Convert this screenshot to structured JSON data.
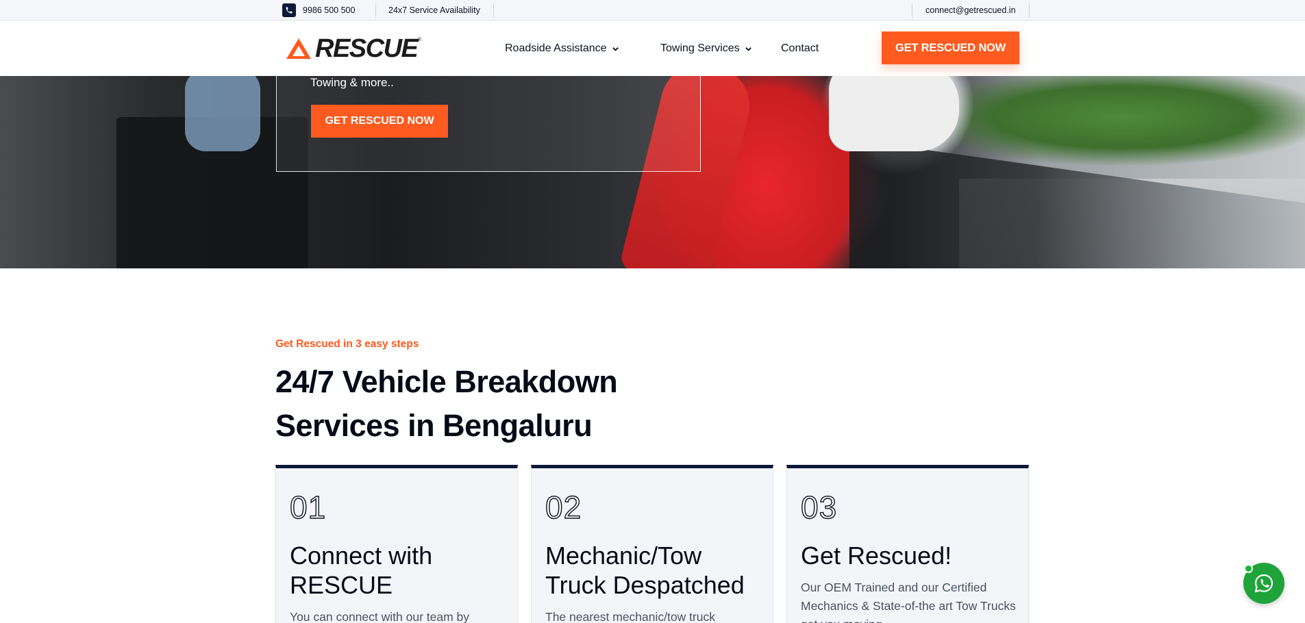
{
  "topbar": {
    "phone": "9986 500 500",
    "availability": "24x7 Service Availability",
    "email": "connect@getrescued.in"
  },
  "header": {
    "logo_text": "RESCUE",
    "logo_reg": "®",
    "nav": [
      {
        "label": "Roadside Assistance",
        "has_dropdown": true
      },
      {
        "label": "Towing Services",
        "has_dropdown": true
      },
      {
        "label": "Contact",
        "has_dropdown": false
      }
    ],
    "cta": "GET RESCUED NOW"
  },
  "hero": {
    "subtitle": "Towing & more..",
    "cta": "GET RESCUED NOW"
  },
  "steps": {
    "eyebrow": "Get Rescued in 3 easy steps",
    "title": "24/7 Vehicle Breakdown Services in Bengaluru",
    "cards": [
      {
        "num": "01",
        "title": "Connect with RESCUE",
        "desc": "You can connect with our team by"
      },
      {
        "num": "02",
        "title": "Mechanic/Tow Truck Despatched",
        "desc": "The nearest mechanic/tow truck"
      },
      {
        "num": "03",
        "title": "Get Rescued!",
        "desc": "Our OEM Trained and our Certified Mechanics & State-of-the art Tow Trucks get you moving"
      }
    ]
  },
  "colors": {
    "accent": "#ff5a1f",
    "navy": "#0b1a3a",
    "whatsapp": "#1fa33b"
  },
  "icons": [
    "phone-icon",
    "chevron-down-icon",
    "rescue-logo-icon",
    "whatsapp-icon"
  ]
}
